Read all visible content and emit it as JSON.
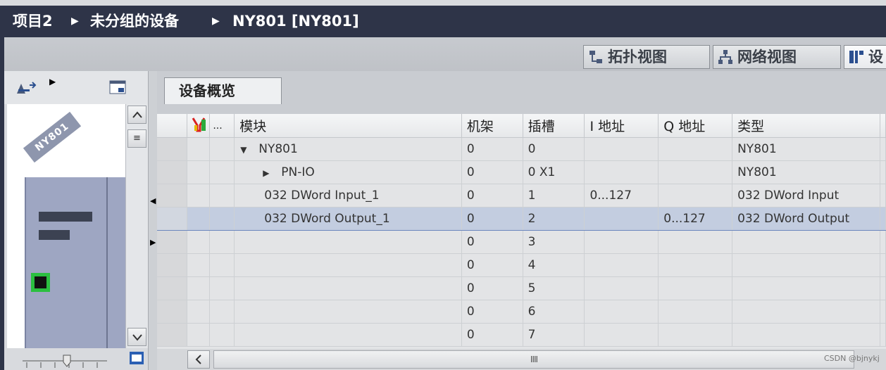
{
  "breadcrumb": {
    "project": "项目2",
    "group": "未分组的设备",
    "device": "NY801 [NY801]"
  },
  "views": {
    "topology": "拓扑视图",
    "network": "网络视图",
    "device": "设"
  },
  "device_graphic": {
    "label": "NY801"
  },
  "overview_tab": "设备概览",
  "table": {
    "headers": {
      "module": "模块",
      "rack": "机架",
      "slot": "插槽",
      "i_addr": "I 地址",
      "q_addr": "Q 地址",
      "type": "类型",
      "dots": "..."
    },
    "rows": [
      {
        "module": "NY801",
        "rack": "0",
        "slot": "0",
        "i_addr": "",
        "q_addr": "",
        "type": "NY801",
        "indent": 1,
        "expander": "expanded"
      },
      {
        "module": "PN-IO",
        "rack": "0",
        "slot": "0 X1",
        "i_addr": "",
        "q_addr": "",
        "type": "NY801",
        "indent": 2,
        "expander": "collapsed"
      },
      {
        "module": "032 DWord Input_1",
        "rack": "0",
        "slot": "1",
        "i_addr": "0...127",
        "q_addr": "",
        "type": "032 DWord Input",
        "indent": 1,
        "expander": ""
      },
      {
        "module": "032 DWord Output_1",
        "rack": "0",
        "slot": "2",
        "i_addr": "",
        "q_addr": "0...127",
        "type": "032 DWord Output",
        "indent": 1,
        "expander": "",
        "selected": true
      },
      {
        "module": "",
        "rack": "0",
        "slot": "3",
        "i_addr": "",
        "q_addr": "",
        "type": ""
      },
      {
        "module": "",
        "rack": "0",
        "slot": "4",
        "i_addr": "",
        "q_addr": "",
        "type": ""
      },
      {
        "module": "",
        "rack": "0",
        "slot": "5",
        "i_addr": "",
        "q_addr": "",
        "type": ""
      },
      {
        "module": "",
        "rack": "0",
        "slot": "6",
        "i_addr": "",
        "q_addr": "",
        "type": ""
      },
      {
        "module": "",
        "rack": "0",
        "slot": "7",
        "i_addr": "",
        "q_addr": "",
        "type": ""
      }
    ]
  },
  "scroll_thumb": "IIII",
  "watermark": "CSDN @bjnykj"
}
